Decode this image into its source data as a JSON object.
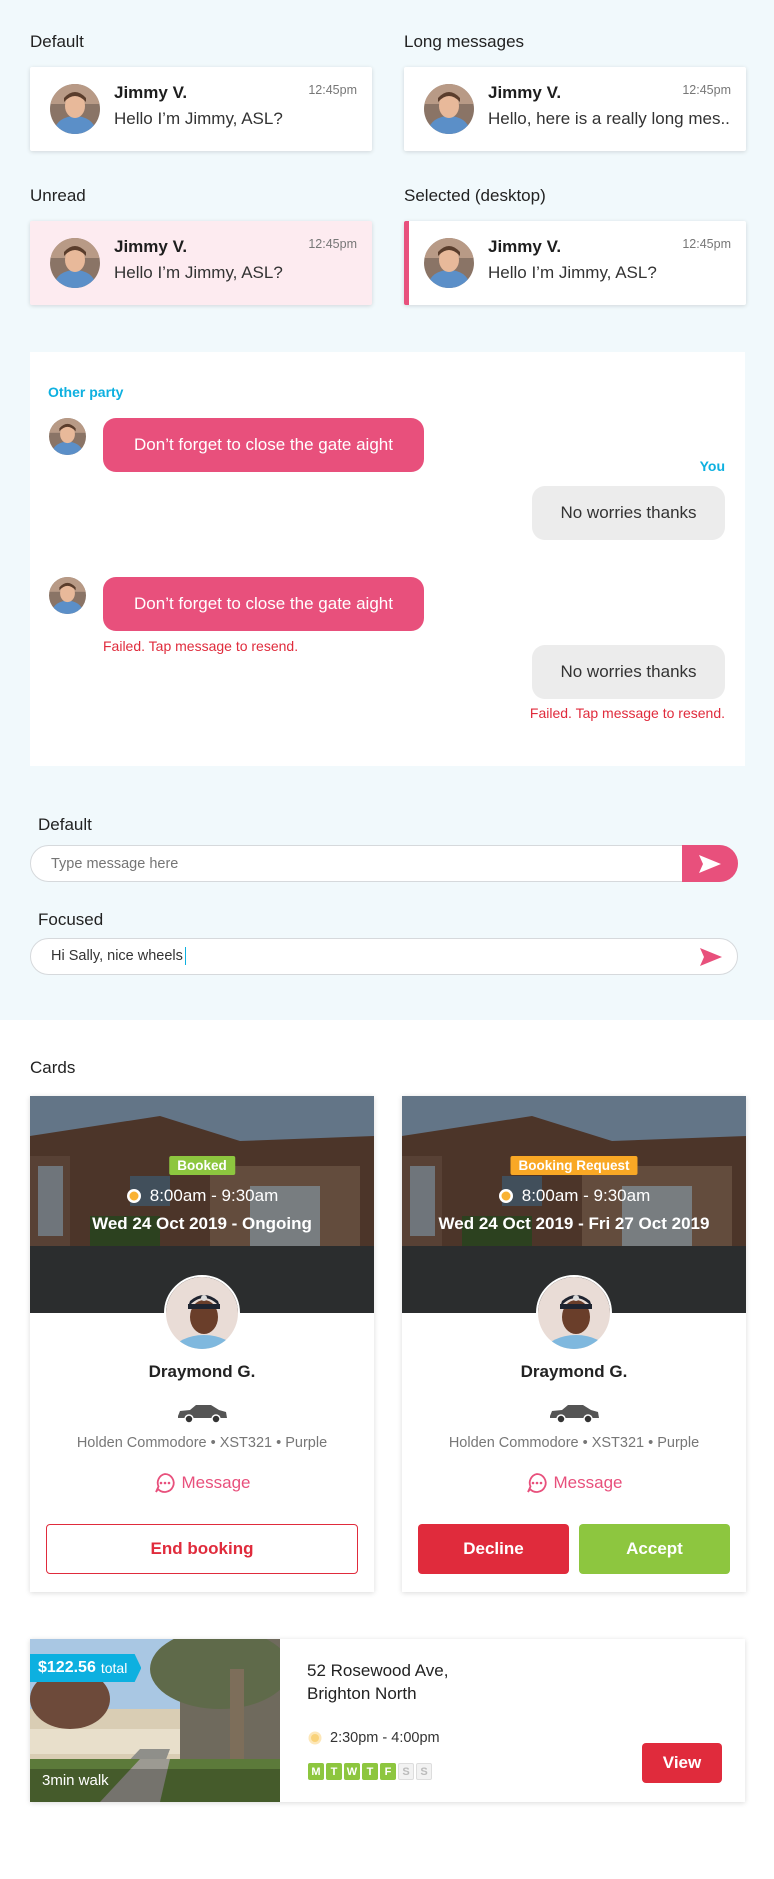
{
  "conversations": {
    "default": {
      "section_label": "Default",
      "name": "Jimmy V.",
      "time": "12:45pm",
      "message": "Hello I’m Jimmy, ASL?"
    },
    "long": {
      "section_label": "Long messages",
      "name": "Jimmy V.",
      "time": "12:45pm",
      "message": "Hello, here is a really long mes.."
    },
    "unread": {
      "section_label": "Unread",
      "name": "Jimmy V.",
      "time": "12:45pm",
      "message": "Hello I’m Jimmy, ASL?"
    },
    "selected": {
      "section_label": "Selected (desktop)",
      "name": "Jimmy V.",
      "time": "12:45pm",
      "message": "Hello I’m Jimmy, ASL?"
    }
  },
  "chat": {
    "other_party_label": "Other party",
    "you_label": "You",
    "messages": [
      {
        "from": "other",
        "text": "Don’t forget to close the gate aight"
      },
      {
        "from": "you",
        "text": "No worries thanks"
      },
      {
        "from": "other",
        "text": "Don’t forget to close the gate aight",
        "error": "Failed. Tap message to resend."
      },
      {
        "from": "you",
        "text": "No worries thanks",
        "error": "Failed. Tap message to resend."
      }
    ]
  },
  "composer": {
    "default_label": "Default",
    "default_placeholder": "Type message here",
    "focused_label": "Focused",
    "focused_value": "Hi Sally, nice wheels"
  },
  "cards": {
    "section_label": "Cards",
    "items": [
      {
        "badge": "Booked",
        "badge_color": "#8dc63f",
        "time": "8:00am - 9:30am",
        "date": "Wed 24 Oct 2019 - Ongoing",
        "name": "Draymond G.",
        "vehicle": "Holden Commodore • XST321 • Purple",
        "message_label": "Message",
        "actions": [
          "End booking"
        ]
      },
      {
        "badge": "Booking Request",
        "badge_color": "#f9a825",
        "time": "8:00am - 9:30am",
        "date": "Wed 24 Oct 2019 - Fri 27 Oct 2019",
        "name": "Draymond G.",
        "vehicle": "Holden Commodore • XST321 • Purple",
        "message_label": "Message",
        "actions": [
          "Decline",
          "Accept"
        ]
      }
    ]
  },
  "listing": {
    "price": "$122.56",
    "price_suffix": "total",
    "walk": "3min walk",
    "address_line1": "52 Rosewood Ave,",
    "address_line2": "Brighton North",
    "time": "2:30pm - 4:00pm",
    "days": [
      {
        "d": "M",
        "active": true
      },
      {
        "d": "T",
        "active": true
      },
      {
        "d": "W",
        "active": true
      },
      {
        "d": "T",
        "active": true
      },
      {
        "d": "F",
        "active": true
      },
      {
        "d": "S",
        "active": false
      },
      {
        "d": "S",
        "active": false
      }
    ],
    "view_label": "View"
  },
  "colors": {
    "pink": "#e8507c",
    "red": "#e02b3c",
    "green": "#8dc63f",
    "cyan": "#0db0e0",
    "orange": "#f9a825"
  }
}
